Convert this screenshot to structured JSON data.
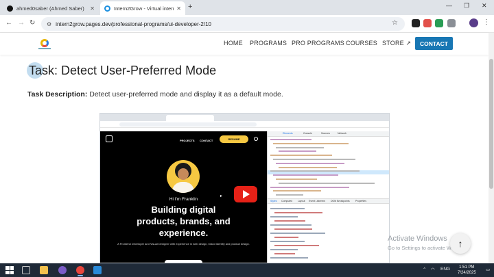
{
  "browser": {
    "tabs": [
      {
        "label": "ahmed0saber (Ahmed Saber)",
        "active": false
      },
      {
        "label": "Intern2Grow - Virtual internshi",
        "active": true
      }
    ],
    "new_tab_symbol": "+",
    "url": "intern2grow.pages.dev/professional-programs/ui-developer-2/10",
    "window_controls": {
      "minimize": "—",
      "maximize": "❐",
      "close": "✕"
    }
  },
  "site": {
    "nav": [
      "HOME",
      "PROGRAMS",
      "PRO PROGRAMS",
      "COURSES",
      "STORE"
    ],
    "contact_label": "CONTACT",
    "accent_color": "#1877b4"
  },
  "task": {
    "title": "Task: Detect User-Preferred Mode",
    "description_label": "Task Description:",
    "description": "Detect user-preferred mode and display it as a default mode."
  },
  "embedded": {
    "nav": [
      "PROJECTS",
      "CONTACT"
    ],
    "resume_label": "RESUME",
    "greeting": "Hi I'm Franklin",
    "headline_lines": [
      "Building digital",
      "products, brands, and",
      "experience."
    ],
    "subtext": "A Frontend Developer and Visual Designer with experience in web design, brand identity and product design.",
    "devtools_tabs": [
      "Elements",
      "Console",
      "Sources",
      "Network"
    ],
    "styles_tabs": [
      "Styles",
      "Computed",
      "Layout",
      "Event Listeners",
      "DOM Breakpoints",
      "Properties"
    ]
  },
  "watermark": {
    "title": "Activate Windows",
    "subtitle": "Go to Settings to activate Windows."
  },
  "taskbar": {
    "lang": "ENG",
    "time": "1:51 PM",
    "date": "7/24/2025"
  }
}
